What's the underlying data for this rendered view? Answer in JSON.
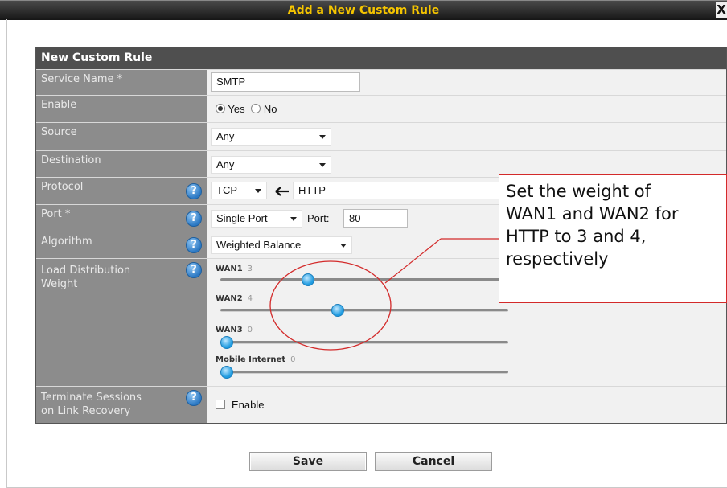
{
  "dialog": {
    "title": "Add a New Custom Rule",
    "close_label": "X"
  },
  "form": {
    "header": "New Custom Rule",
    "service_name": {
      "label": "Service Name *",
      "value": "SMTP"
    },
    "enable": {
      "label": "Enable",
      "yes_label": "Yes",
      "no_label": "No",
      "selected": "Yes"
    },
    "source": {
      "label": "Source",
      "value": "Any"
    },
    "destination": {
      "label": "Destination",
      "value": "Any"
    },
    "protocol": {
      "label": "Protocol",
      "value": "TCP",
      "preset_value": "HTTP"
    },
    "port": {
      "label": "Port *",
      "type_value": "Single Port",
      "port_label": "Port:",
      "port_value": "80"
    },
    "algorithm": {
      "label": "Algorithm",
      "value": "Weighted Balance"
    },
    "load_distribution": {
      "label_line1": "Load Distribution",
      "label_line2": "Weight",
      "sliders": [
        {
          "name": "WAN1",
          "value": "3"
        },
        {
          "name": "WAN2",
          "value": "4"
        },
        {
          "name": "WAN3",
          "value": "0"
        },
        {
          "name": "Mobile Internet",
          "value": "0"
        }
      ]
    },
    "terminate_sessions": {
      "label_line1": "Terminate Sessions",
      "label_line2": "on Link Recovery",
      "checkbox_label": "Enable",
      "checked": false
    },
    "help_icon": "?"
  },
  "buttons": {
    "save": "Save",
    "cancel": "Cancel"
  },
  "annotation": {
    "line1": "Set the weight of",
    "line2": "WAN1 and WAN2 for",
    "line3": "HTTP to 3 and 4,",
    "line4": "respectively",
    "color": "#d32a2a"
  },
  "colors": {
    "title_text": "#f4c400",
    "label_bg": "#8c8c8c",
    "header_bg": "#4f4f4f",
    "slider_knob": "#1f9be0"
  }
}
